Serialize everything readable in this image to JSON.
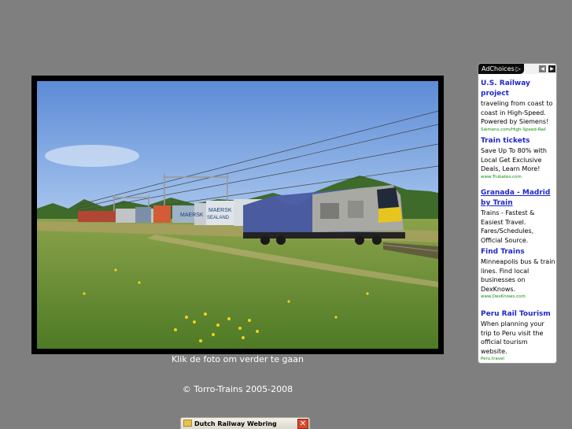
{
  "photo": {
    "caption": "Klik de foto om verder te gaan",
    "train_text_1": "MAERSK",
    "train_text_2": "MAERSK",
    "train_text_3": "SEALAND"
  },
  "footer": {
    "copyright": "© Torro-Trains 2005-2008"
  },
  "ads": {
    "adchoices_label": "AdChoices",
    "items": [
      {
        "title": "U.S. Railway project",
        "body": "traveling from coast to coast in High-Speed. Powered by Siemens!",
        "url": "Siemens.com/High-Speed-Rail"
      },
      {
        "title": "Train tickets",
        "body": "Save Up To 80% with Local Get Exclusive Deals, Learn More!",
        "url": "www.Trubates.com"
      },
      {
        "title": "Granada - Madrid by Train",
        "body": "Trains - Fastest & Easiest Travel. Fares/Schedules, Official Source.",
        "url": ""
      },
      {
        "title": "Find Trains",
        "body": "Minneapolis bus & train lines. Find local businesses on DexKnows.",
        "url": "www.DexKnows.com"
      },
      {
        "title": "Peru Rail Tourism",
        "body": "When planning your trip to Peru visit the official tourism website.",
        "url": "Peru.travel"
      }
    ]
  },
  "webring": {
    "title": "Dutch Railway Webring",
    "close_glyph": "✕"
  },
  "colors": {
    "page_bg": "#7f7f7f",
    "ad_title": "#1e27c9",
    "ad_url": "#0c8c0c"
  }
}
